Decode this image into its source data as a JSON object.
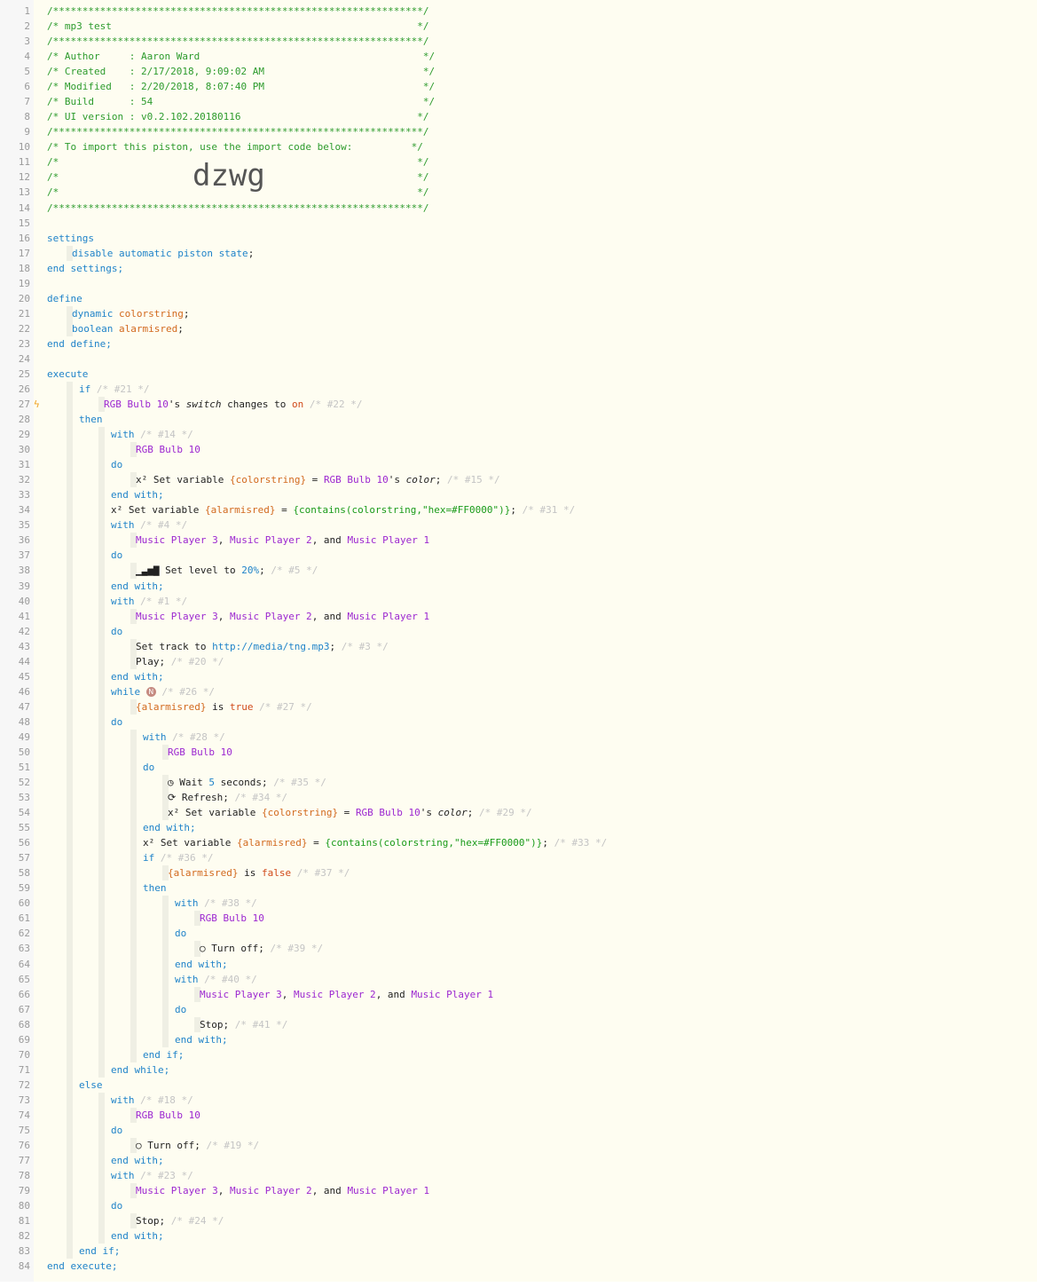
{
  "import_code": "dzwg",
  "lines": [
    {
      "n": "1",
      "i": 53,
      "s": [
        [
          "/***************************************************************/",
          "hdr"
        ]
      ]
    },
    {
      "n": "2",
      "i": 53,
      "s": [
        [
          "/* mp3 test                                                    */",
          "hdr"
        ]
      ]
    },
    {
      "n": "3",
      "i": 53,
      "s": [
        [
          "/***************************************************************/",
          "hdr"
        ]
      ]
    },
    {
      "n": "4",
      "i": 53,
      "s": [
        [
          "/* Author     : Aaron Ward                                      */",
          "hdr"
        ]
      ]
    },
    {
      "n": "5",
      "i": 53,
      "s": [
        [
          "/* Created    : 2/17/2018, 9:09:02 AM                           */",
          "hdr"
        ]
      ]
    },
    {
      "n": "6",
      "i": 53,
      "s": [
        [
          "/* Modified   : 2/20/2018, 8:07:40 PM                           */",
          "hdr"
        ]
      ]
    },
    {
      "n": "7",
      "i": 53,
      "s": [
        [
          "/* Build      : 54                                              */",
          "hdr"
        ]
      ]
    },
    {
      "n": "8",
      "i": 53,
      "s": [
        [
          "/* UI version : v0.2.102.20180116                              */",
          "hdr"
        ]
      ]
    },
    {
      "n": "9",
      "i": 53,
      "s": [
        [
          "/***************************************************************/",
          "hdr"
        ]
      ]
    },
    {
      "n": "10",
      "i": 53,
      "s": [
        [
          "/* To import this piston, use the import code below:          */",
          "hdr"
        ]
      ]
    },
    {
      "n": "11",
      "i": 53,
      "s": [
        [
          "/*                                                             */",
          "hdr"
        ]
      ]
    },
    {
      "n": "12",
      "i": 53,
      "s": [
        [
          "/*                                                             */",
          "hdr"
        ]
      ]
    },
    {
      "n": "13",
      "i": 53,
      "s": [
        [
          "/*                                                             */",
          "hdr"
        ]
      ]
    },
    {
      "n": "14",
      "i": 53,
      "s": [
        [
          "/***************************************************************/",
          "hdr"
        ]
      ]
    },
    {
      "n": "15",
      "i": 53,
      "s": []
    },
    {
      "n": "16",
      "i": 53,
      "s": [
        [
          "settings",
          "kw"
        ]
      ]
    },
    {
      "n": "17",
      "i": 81,
      "g": [
        53
      ],
      "s": [
        [
          "disable automatic piston state",
          "kw"
        ],
        [
          ";",
          ""
        ]
      ]
    },
    {
      "n": "18",
      "i": 53,
      "s": [
        [
          "end settings;",
          "kw"
        ]
      ]
    },
    {
      "n": "19",
      "i": 53,
      "s": []
    },
    {
      "n": "20",
      "i": 53,
      "s": [
        [
          "define",
          "kw"
        ]
      ]
    },
    {
      "n": "21",
      "i": 81,
      "g": [
        53
      ],
      "s": [
        [
          "dynamic ",
          "kw"
        ],
        [
          "colorstring",
          "var"
        ],
        [
          ";",
          ""
        ]
      ]
    },
    {
      "n": "22",
      "i": 81,
      "g": [
        53
      ],
      "s": [
        [
          "boolean ",
          "kw"
        ],
        [
          "alarmisred",
          "var"
        ],
        [
          ";",
          ""
        ]
      ]
    },
    {
      "n": "23",
      "i": 53,
      "s": [
        [
          "end define;",
          "kw"
        ]
      ]
    },
    {
      "n": "24",
      "i": 53,
      "s": []
    },
    {
      "n": "25",
      "i": 53,
      "s": [
        [
          "execute",
          "kw"
        ]
      ]
    },
    {
      "n": "26",
      "i": 89,
      "g": [
        53
      ],
      "s": [
        [
          "if ",
          "kw"
        ],
        [
          "/* #21 */",
          "cmt"
        ]
      ]
    },
    {
      "n": "27",
      "i": 117,
      "g": [
        53,
        89
      ],
      "bolt": true,
      "s": [
        [
          "RGB Bulb 10",
          "dev"
        ],
        [
          "'s ",
          ""
        ],
        [
          "switch",
          "ital"
        ],
        [
          " changes to ",
          ""
        ],
        [
          "on",
          "lit"
        ],
        [
          " ",
          ""
        ],
        [
          "/* #22 */",
          "cmt"
        ]
      ]
    },
    {
      "n": "28",
      "i": 89,
      "g": [
        53
      ],
      "s": [
        [
          "then",
          "kw"
        ]
      ]
    },
    {
      "n": "29",
      "i": 125,
      "g": [
        53,
        89
      ],
      "s": [
        [
          "with ",
          "kw"
        ],
        [
          "/* #14 */",
          "cmt"
        ]
      ]
    },
    {
      "n": "30",
      "i": 153,
      "g": [
        53,
        89,
        125
      ],
      "s": [
        [
          "RGB Bulb 10",
          "dev"
        ]
      ]
    },
    {
      "n": "31",
      "i": 125,
      "g": [
        53,
        89
      ],
      "s": [
        [
          "do",
          "kw"
        ]
      ]
    },
    {
      "n": "32",
      "i": 153,
      "g": [
        53,
        89,
        125
      ],
      "s": [
        [
          "x² Set variable ",
          ""
        ],
        [
          "{colorstring}",
          "var"
        ],
        [
          " = ",
          ""
        ],
        [
          "RGB Bulb 10",
          "dev"
        ],
        [
          "'s ",
          ""
        ],
        [
          "color",
          "ital"
        ],
        [
          "; ",
          ""
        ],
        [
          "/* #15 */",
          "cmt"
        ]
      ]
    },
    {
      "n": "33",
      "i": 125,
      "g": [
        53,
        89
      ],
      "s": [
        [
          "end with;",
          "kw"
        ]
      ]
    },
    {
      "n": "34",
      "i": 125,
      "g": [
        53,
        89
      ],
      "s": [
        [
          "x² Set variable ",
          ""
        ],
        [
          "{alarmisred}",
          "var"
        ],
        [
          " = ",
          ""
        ],
        [
          "{contains(colorstring,\"hex=#FF0000\")}",
          "str"
        ],
        [
          "; ",
          ""
        ],
        [
          "/* #31 */",
          "cmt"
        ]
      ]
    },
    {
      "n": "35",
      "i": 125,
      "g": [
        53,
        89
      ],
      "s": [
        [
          "with ",
          "kw"
        ],
        [
          "/* #4 */",
          "cmt"
        ]
      ]
    },
    {
      "n": "36",
      "i": 153,
      "g": [
        53,
        89,
        125
      ],
      "s": [
        [
          "Music Player 3",
          "dev"
        ],
        [
          ", ",
          ""
        ],
        [
          "Music Player 2",
          "dev"
        ],
        [
          ", and ",
          ""
        ],
        [
          "Music Player 1",
          "dev"
        ]
      ]
    },
    {
      "n": "37",
      "i": 125,
      "g": [
        53,
        89
      ],
      "s": [
        [
          "do",
          "kw"
        ]
      ]
    },
    {
      "n": "38",
      "i": 153,
      "g": [
        53,
        89,
        125
      ],
      "s": [
        [
          "▁▃▅▇ Set level to ",
          ""
        ],
        [
          "20%",
          "kw"
        ],
        [
          "; ",
          ""
        ],
        [
          "/* #5 */",
          "cmt"
        ]
      ]
    },
    {
      "n": "39",
      "i": 125,
      "g": [
        53,
        89
      ],
      "s": [
        [
          "end with;",
          "kw"
        ]
      ]
    },
    {
      "n": "40",
      "i": 125,
      "g": [
        53,
        89
      ],
      "s": [
        [
          "with ",
          "kw"
        ],
        [
          "/* #1 */",
          "cmt"
        ]
      ]
    },
    {
      "n": "41",
      "i": 153,
      "g": [
        53,
        89,
        125
      ],
      "s": [
        [
          "Music Player 3",
          "dev"
        ],
        [
          ", ",
          ""
        ],
        [
          "Music Player 2",
          "dev"
        ],
        [
          ", and ",
          ""
        ],
        [
          "Music Player 1",
          "dev"
        ]
      ]
    },
    {
      "n": "42",
      "i": 125,
      "g": [
        53,
        89
      ],
      "s": [
        [
          "do",
          "kw"
        ]
      ]
    },
    {
      "n": "43",
      "i": 153,
      "g": [
        53,
        89,
        125
      ],
      "s": [
        [
          "Set track to ",
          ""
        ],
        [
          "http://media/tng.mp3",
          "kw"
        ],
        [
          "; ",
          ""
        ],
        [
          "/* #3 */",
          "cmt"
        ]
      ]
    },
    {
      "n": "44",
      "i": 153,
      "g": [
        53,
        89,
        125
      ],
      "s": [
        [
          "Play; ",
          ""
        ],
        [
          "/* #20 */",
          "cmt"
        ]
      ]
    },
    {
      "n": "45",
      "i": 125,
      "g": [
        53,
        89
      ],
      "s": [
        [
          "end with;",
          "kw"
        ]
      ]
    },
    {
      "n": "46",
      "i": 125,
      "g": [
        53,
        89
      ],
      "s": [
        [
          "while ",
          "kw"
        ],
        [
          "N",
          "badge"
        ],
        [
          " ",
          ""
        ],
        [
          "/* #26 */",
          "cmt"
        ]
      ]
    },
    {
      "n": "47",
      "i": 153,
      "g": [
        53,
        89,
        125
      ],
      "s": [
        [
          "{alarmisred}",
          "var"
        ],
        [
          " is ",
          ""
        ],
        [
          "true",
          "lit"
        ],
        [
          " ",
          ""
        ],
        [
          "/* #27 */",
          "cmt"
        ]
      ]
    },
    {
      "n": "48",
      "i": 125,
      "g": [
        53,
        89
      ],
      "s": [
        [
          "do",
          "kw"
        ]
      ]
    },
    {
      "n": "49",
      "i": 161,
      "g": [
        53,
        89,
        125
      ],
      "s": [
        [
          "with ",
          "kw"
        ],
        [
          "/* #28 */",
          "cmt"
        ]
      ]
    },
    {
      "n": "50",
      "i": 189,
      "g": [
        53,
        89,
        125,
        161
      ],
      "s": [
        [
          "RGB Bulb 10",
          "dev"
        ]
      ]
    },
    {
      "n": "51",
      "i": 161,
      "g": [
        53,
        89,
        125
      ],
      "s": [
        [
          "do",
          "kw"
        ]
      ]
    },
    {
      "n": "52",
      "i": 189,
      "g": [
        53,
        89,
        125,
        161
      ],
      "s": [
        [
          "◷ Wait ",
          ""
        ],
        [
          "5",
          "kw"
        ],
        [
          " seconds; ",
          ""
        ],
        [
          "/* #35 */",
          "cmt"
        ]
      ]
    },
    {
      "n": "53",
      "i": 189,
      "g": [
        53,
        89,
        125,
        161
      ],
      "s": [
        [
          "⟳ Refresh; ",
          ""
        ],
        [
          "/* #34 */",
          "cmt"
        ]
      ]
    },
    {
      "n": "54",
      "i": 189,
      "g": [
        53,
        89,
        125,
        161
      ],
      "s": [
        [
          "x² Set variable ",
          ""
        ],
        [
          "{colorstring}",
          "var"
        ],
        [
          " = ",
          ""
        ],
        [
          "RGB Bulb 10",
          "dev"
        ],
        [
          "'s ",
          ""
        ],
        [
          "color",
          "ital"
        ],
        [
          "; ",
          ""
        ],
        [
          "/* #29 */",
          "cmt"
        ]
      ]
    },
    {
      "n": "55",
      "i": 161,
      "g": [
        53,
        89,
        125
      ],
      "s": [
        [
          "end with;",
          "kw"
        ]
      ]
    },
    {
      "n": "56",
      "i": 161,
      "g": [
        53,
        89,
        125
      ],
      "s": [
        [
          "x² Set variable ",
          ""
        ],
        [
          "{alarmisred}",
          "var"
        ],
        [
          " = ",
          ""
        ],
        [
          "{contains(colorstring,\"hex=#FF0000\")}",
          "str"
        ],
        [
          "; ",
          ""
        ],
        [
          "/* #33 */",
          "cmt"
        ]
      ]
    },
    {
      "n": "57",
      "i": 161,
      "g": [
        53,
        89,
        125
      ],
      "s": [
        [
          "if ",
          "kw"
        ],
        [
          "/* #36 */",
          "cmt"
        ]
      ]
    },
    {
      "n": "58",
      "i": 189,
      "g": [
        53,
        89,
        125,
        161
      ],
      "s": [
        [
          "{alarmisred}",
          "var"
        ],
        [
          " is ",
          ""
        ],
        [
          "false",
          "lit"
        ],
        [
          " ",
          ""
        ],
        [
          "/* #37 */",
          "cmt"
        ]
      ]
    },
    {
      "n": "59",
      "i": 161,
      "g": [
        53,
        89,
        125
      ],
      "s": [
        [
          "then",
          "kw"
        ]
      ]
    },
    {
      "n": "60",
      "i": 197,
      "g": [
        53,
        89,
        125,
        161
      ],
      "s": [
        [
          "with ",
          "kw"
        ],
        [
          "/* #38 */",
          "cmt"
        ]
      ]
    },
    {
      "n": "61",
      "i": 225,
      "g": [
        53,
        89,
        125,
        161,
        197
      ],
      "s": [
        [
          "RGB Bulb 10",
          "dev"
        ]
      ]
    },
    {
      "n": "62",
      "i": 197,
      "g": [
        53,
        89,
        125,
        161
      ],
      "s": [
        [
          "do",
          "kw"
        ]
      ]
    },
    {
      "n": "63",
      "i": 225,
      "g": [
        53,
        89,
        125,
        161,
        197
      ],
      "s": [
        [
          "○ Turn off; ",
          ""
        ],
        [
          "/* #39 */",
          "cmt"
        ]
      ]
    },
    {
      "n": "64",
      "i": 197,
      "g": [
        53,
        89,
        125,
        161
      ],
      "s": [
        [
          "end with;",
          "kw"
        ]
      ]
    },
    {
      "n": "65",
      "i": 197,
      "g": [
        53,
        89,
        125,
        161
      ],
      "s": [
        [
          "with ",
          "kw"
        ],
        [
          "/* #40 */",
          "cmt"
        ]
      ]
    },
    {
      "n": "66",
      "i": 225,
      "g": [
        53,
        89,
        125,
        161,
        197
      ],
      "s": [
        [
          "Music Player 3",
          "dev"
        ],
        [
          ", ",
          ""
        ],
        [
          "Music Player 2",
          "dev"
        ],
        [
          ", and ",
          ""
        ],
        [
          "Music Player 1",
          "dev"
        ]
      ]
    },
    {
      "n": "67",
      "i": 197,
      "g": [
        53,
        89,
        125,
        161
      ],
      "s": [
        [
          "do",
          "kw"
        ]
      ]
    },
    {
      "n": "68",
      "i": 225,
      "g": [
        53,
        89,
        125,
        161,
        197
      ],
      "s": [
        [
          "Stop; ",
          ""
        ],
        [
          "/* #41 */",
          "cmt"
        ]
      ]
    },
    {
      "n": "69",
      "i": 197,
      "g": [
        53,
        89,
        125,
        161
      ],
      "s": [
        [
          "end with;",
          "kw"
        ]
      ]
    },
    {
      "n": "70",
      "i": 161,
      "g": [
        53,
        89,
        125
      ],
      "s": [
        [
          "end if;",
          "kw"
        ]
      ]
    },
    {
      "n": "71",
      "i": 125,
      "g": [
        53,
        89
      ],
      "s": [
        [
          "end while;",
          "kw"
        ]
      ]
    },
    {
      "n": "72",
      "i": 89,
      "g": [
        53
      ],
      "s": [
        [
          "else",
          "kw"
        ]
      ]
    },
    {
      "n": "73",
      "i": 125,
      "g": [
        53,
        89
      ],
      "s": [
        [
          "with ",
          "kw"
        ],
        [
          "/* #18 */",
          "cmt"
        ]
      ]
    },
    {
      "n": "74",
      "i": 153,
      "g": [
        53,
        89,
        125
      ],
      "s": [
        [
          "RGB Bulb 10",
          "dev"
        ]
      ]
    },
    {
      "n": "75",
      "i": 125,
      "g": [
        53,
        89
      ],
      "s": [
        [
          "do",
          "kw"
        ]
      ]
    },
    {
      "n": "76",
      "i": 153,
      "g": [
        53,
        89,
        125
      ],
      "s": [
        [
          "○ Turn off; ",
          ""
        ],
        [
          "/* #19 */",
          "cmt"
        ]
      ]
    },
    {
      "n": "77",
      "i": 125,
      "g": [
        53,
        89
      ],
      "s": [
        [
          "end with;",
          "kw"
        ]
      ]
    },
    {
      "n": "78",
      "i": 125,
      "g": [
        53,
        89
      ],
      "s": [
        [
          "with ",
          "kw"
        ],
        [
          "/* #23 */",
          "cmt"
        ]
      ]
    },
    {
      "n": "79",
      "i": 153,
      "g": [
        53,
        89,
        125
      ],
      "s": [
        [
          "Music Player 3",
          "dev"
        ],
        [
          ", ",
          ""
        ],
        [
          "Music Player 2",
          "dev"
        ],
        [
          ", and ",
          ""
        ],
        [
          "Music Player 1",
          "dev"
        ]
      ]
    },
    {
      "n": "80",
      "i": 125,
      "g": [
        53,
        89
      ],
      "s": [
        [
          "do",
          "kw"
        ]
      ]
    },
    {
      "n": "81",
      "i": 153,
      "g": [
        53,
        89,
        125
      ],
      "s": [
        [
          "Stop; ",
          ""
        ],
        [
          "/* #24 */",
          "cmt"
        ]
      ]
    },
    {
      "n": "82",
      "i": 125,
      "g": [
        53,
        89
      ],
      "s": [
        [
          "end with;",
          "kw"
        ]
      ]
    },
    {
      "n": "83",
      "i": 89,
      "g": [
        53
      ],
      "s": [
        [
          "end if;",
          "kw"
        ]
      ]
    },
    {
      "n": "84",
      "i": 53,
      "s": [
        [
          "end execute;",
          "kw"
        ]
      ]
    }
  ]
}
